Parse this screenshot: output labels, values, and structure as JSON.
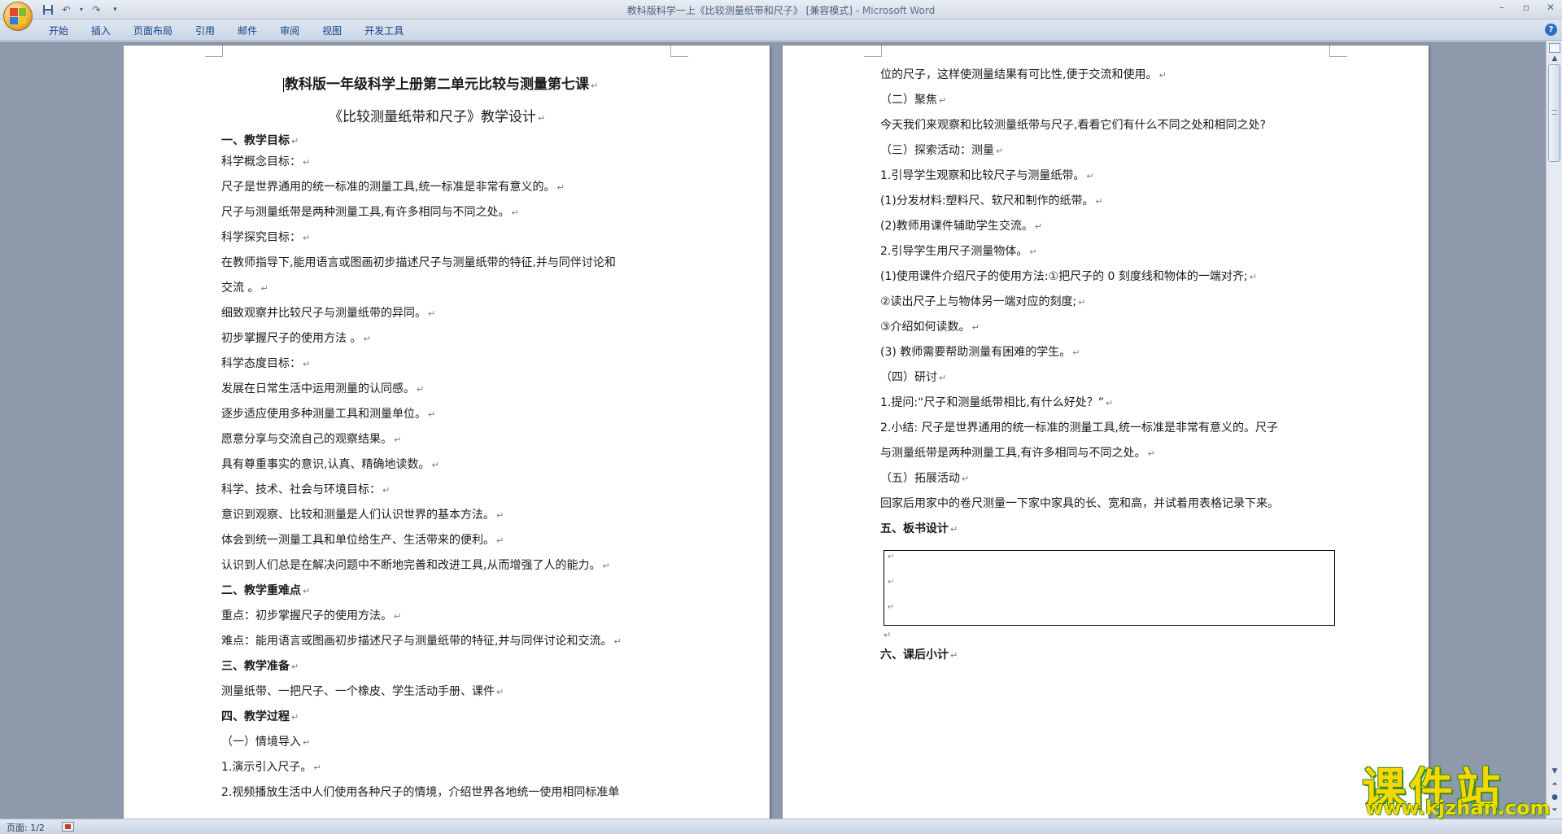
{
  "window": {
    "title_doc": "教科版科学一上《比较测量纸带和尺子》 [兼容模式] - ",
    "title_app": "Microsoft Word"
  },
  "quick_access": {
    "icons": [
      "save-icon",
      "undo-icon",
      "redo-icon",
      "customize-icon"
    ]
  },
  "ribbon": {
    "tabs": [
      "开始",
      "插入",
      "页面布局",
      "引用",
      "邮件",
      "审阅",
      "视图",
      "开发工具"
    ]
  },
  "page1": {
    "lines": [
      "教科版一年级科学上册第二单元比较与测量第七课",
      "《比较测量纸带和尺子》教学设计",
      "一、教学目标",
      "科学概念目标：",
      " 尺子是世界通用的统一标准的测量工具,统一标准是非常有意义的。",
      "尺子与测量纸带是两种测量工具,有许多相同与不同之处。",
      "科学探究目标：",
      "在教师指导下,能用语言或图画初步描述尺子与测量纸带的特征,并与同伴讨论和",
      "交流 。",
      "细致观察并比较尺子与测量纸带的异同。",
      "初步掌握尺子的使用方法 。",
      "科学态度目标：",
      "发展在日常生活中运用测量的认同感。",
      "逐步适应使用多种测量工具和测量单位。",
      "愿意分享与交流自己的观察结果。",
      "具有尊重事实的意识,认真、精确地读数。",
      "科学、技术、社会与环境目标：",
      "意识到观察、比较和测量是人们认识世界的基本方法。",
      "体会到统一测量工具和单位给生产、生活带来的便利。",
      "认识到人们总是在解决问题中不断地完善和改进工具,从而增强了人的能力。",
      "二、教学重难点",
      "重点：初步掌握尺子的使用方法。",
      "难点：能用语言或图画初步描述尺子与测量纸带的特征,并与同伴讨论和交流。",
      "三、教学准备",
      "测量纸带、一把尺子、一个橡皮、学生活动手册、课件",
      "四、教学过程",
      "（一）情境导入",
      "1.演示引入尺子。",
      "2.视频播放生活中人们使用各种尺子的情境，介绍世界各地统一使用相同标准单"
    ]
  },
  "page2": {
    "lines": [
      "位的尺子，这样使测量结果有可比性,便于交流和使用。",
      "（二）聚焦",
      "今天我们来观察和比较测量纸带与尺子,看看它们有什么不同之处和相同之处?",
      "（三）探索活动：测量",
      "1.引导学生观察和比较尺子与测量纸带。",
      "(1)分发材料:塑料尺、软尺和制作的纸带。",
      "(2)教师用课件辅助学生交流。",
      "2.引导学生用尺子测量物体。",
      "(1)使用课件介绍尺子的使用方法:①把尺子的 0 刻度线和物体的一端对齐;",
      "②读出尺子上与物体另一端对应的刻度;",
      "③介绍如何读数。",
      "(3) 教师需要帮助测量有困难的学生。",
      "（四）研讨",
      "1.提问:“尺子和测量纸带相比,有什么好处？”",
      "2.小结: 尺子是世界通用的统一标准的测量工具,统一标准是非常有意义的。尺子",
      "与测量纸带是两种测量工具,有许多相同与不同之处。",
      "（五）拓展活动",
      "回家后用家中的卷尺测量一下家中家具的长、宽和高，并试着用表格记录下来。",
      "五、板书设计",
      "六、课后小计"
    ]
  },
  "marks": {
    "paragraph": "↵"
  },
  "statusbar": {
    "page_count": "页面: 1/2"
  },
  "watermark": {
    "title": "课件站",
    "url": "www.kjzhan.com"
  }
}
